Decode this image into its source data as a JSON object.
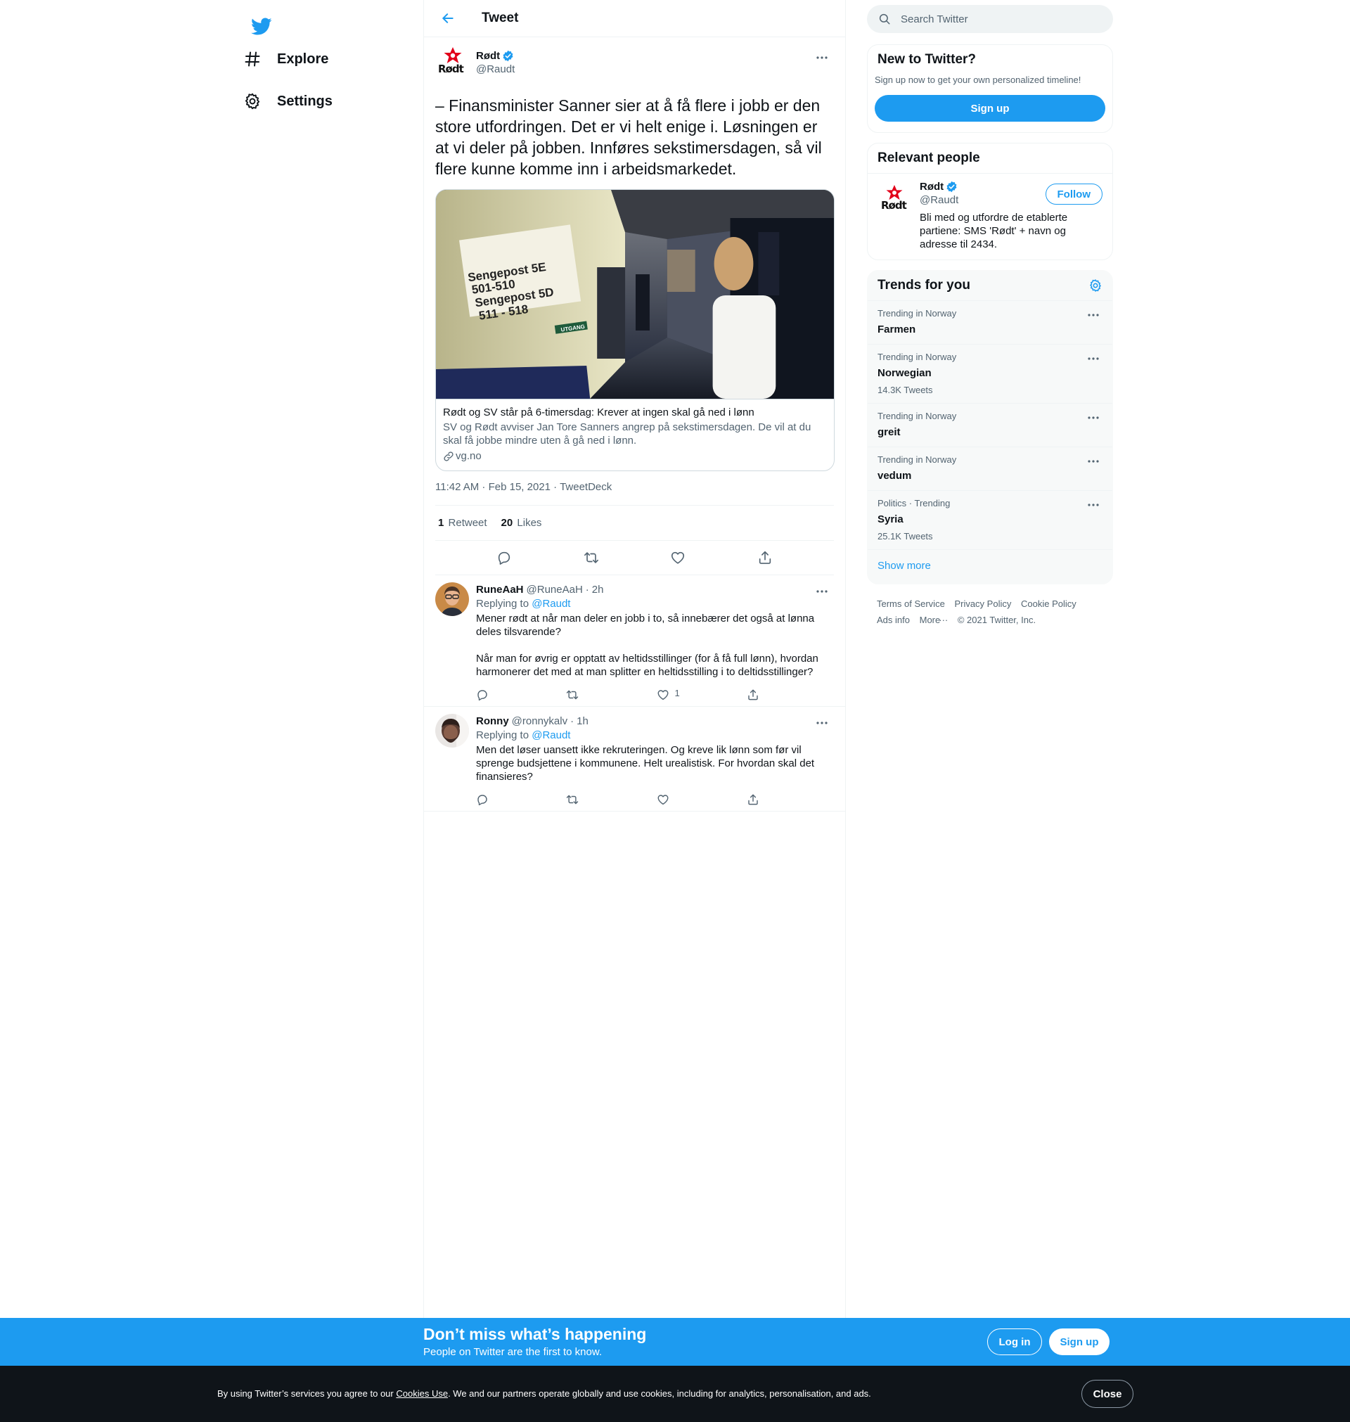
{
  "nav": {
    "logo_icon": "twitter-bird-icon",
    "items": [
      {
        "label": "Explore",
        "icon": "hashtag-icon"
      },
      {
        "label": "Settings",
        "icon": "gear-icon"
      }
    ]
  },
  "header": {
    "title": "Tweet",
    "back_icon": "arrow-left-icon"
  },
  "tweet": {
    "author": {
      "name": "Rødt",
      "handle": "@Raudt",
      "logo_text": "Rødt",
      "verified": true
    },
    "text": "– Finansminister Sanner sier at å få flere i jobb er den store utfordringen. Det er vi helt enige i. Løsningen er at vi deler på jobben. Innføres sekstimersdagen, så vil flere kunne komme inn i arbeidsmarkedet.",
    "card": {
      "title": "Rødt og SV står på 6-timersdag: Krever at ingen skal gå ned i lønn",
      "description": "SV og Rødt avviser Jan Tore Sanners angrep på sekstimersdagen. De vil at du skal få jobbe mindre uten å gå ned i lønn.",
      "domain": "vg.no",
      "sign_lines": [
        "Sengepost 5E",
        "501-510",
        "Sengepost 5D",
        "511 - 518"
      ],
      "exit_sign": "UTGANG"
    },
    "time": "11:42 AM",
    "date": "Feb 15, 2021",
    "source": "TweetDeck",
    "retweets_count": "1",
    "retweets_label": "Retweet",
    "likes_count": "20",
    "likes_label": "Likes"
  },
  "replies": [
    {
      "name": "RuneAaH",
      "handle": "@RuneAaH",
      "time": "2h",
      "replying_prefix": "Replying to",
      "replying_to": "@Raudt",
      "text": "Mener rødt at  når man deler en jobb i to, så innebærer det også at lønna deles tilsvarende?\n\nNår man for øvrig er opptatt av heltidsstillinger (for å få full lønn), hvordan harmonerer det med at man splitter en heltidsstilling i to deltidsstillinger?",
      "likes": "1"
    },
    {
      "name": "Ronny",
      "handle": "@ronnykalv",
      "time": "1h",
      "replying_prefix": "Replying to",
      "replying_to": "@Raudt",
      "text": "Men det løser uansett ikke rekruteringen. Og kreve lik lønn som før vil sprenge budsjettene i kommunene. Helt urealistisk. For hvordan skal det finansieres?",
      "likes": ""
    }
  ],
  "sidebar": {
    "search_placeholder": "Search Twitter",
    "new_to_twitter": {
      "title": "New to Twitter?",
      "subtitle": "Sign up now to get your own personalized timeline!",
      "button": "Sign up"
    },
    "relevant_people": {
      "title": "Relevant people",
      "person": {
        "name": "Rødt",
        "handle": "@Raudt",
        "logo_text": "Rødt",
        "bio": "Bli med og utfordre de etablerte partiene: SMS 'Rødt' + navn og adresse til 2434.",
        "follow": "Follow"
      }
    },
    "trends": {
      "title": "Trends for you",
      "items": [
        {
          "context": "Trending in Norway",
          "name": "Farmen",
          "count": ""
        },
        {
          "context": "Trending in Norway",
          "name": "Norwegian",
          "count": "14.3K Tweets"
        },
        {
          "context": "Trending in Norway",
          "name": "greit",
          "count": ""
        },
        {
          "context": "Trending in Norway",
          "name": "vedum",
          "count": ""
        },
        {
          "context": "Politics · Trending",
          "name": "Syria",
          "count": "25.1K Tweets"
        }
      ],
      "show_more": "Show more"
    },
    "footer": {
      "terms": "Terms of Service",
      "privacy": "Privacy Policy",
      "cookie": "Cookie Policy",
      "ads": "Ads info",
      "more": "More",
      "copyright": "© 2021 Twitter, Inc."
    }
  },
  "promo": {
    "title": "Don’t miss what’s happening",
    "subtitle": "People on Twitter are the first to know.",
    "login": "Log in",
    "signup": "Sign up"
  },
  "cookie_bar": {
    "prefix": "By using Twitter’s services you agree to our ",
    "link": "Cookies Use",
    "suffix": ". We and our partners operate globally and use cookies, including for analytics, personalisation, and ads.",
    "close": "Close"
  },
  "colors": {
    "accent": "#1d9bf0",
    "text": "#0f1419",
    "muted": "#536471",
    "border": "#eff3f4",
    "cookie_bg": "#0f1419",
    "rodt_red": "#e2001a"
  }
}
